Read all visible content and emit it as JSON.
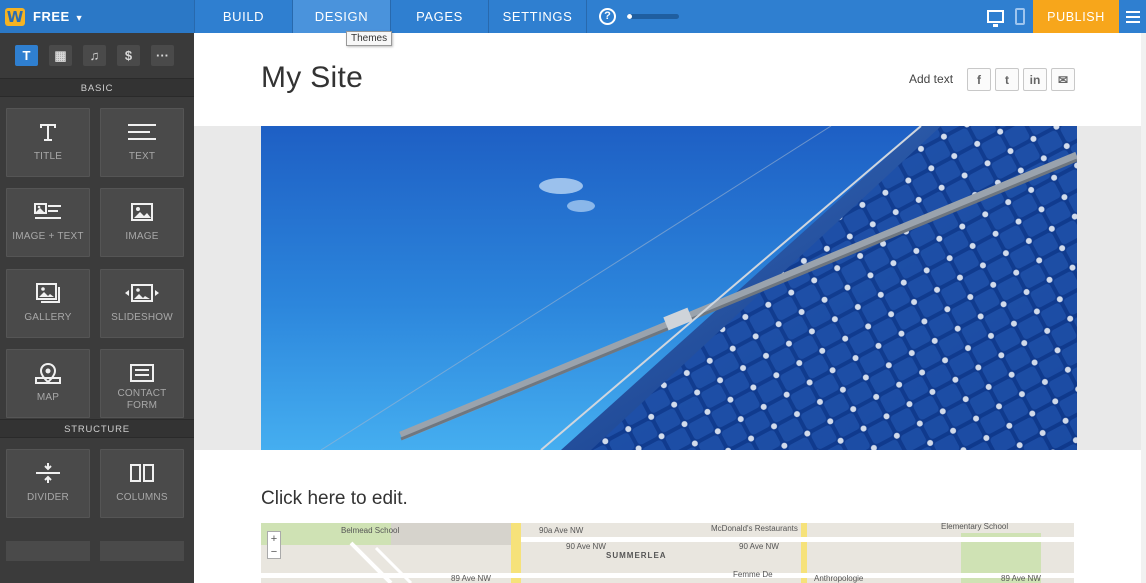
{
  "topbar": {
    "logo_letter": "W",
    "plan_label": "FREE",
    "nav": [
      "BUILD",
      "DESIGN",
      "PAGES",
      "SETTINGS"
    ],
    "active_nav": "DESIGN",
    "help_glyph": "?",
    "publish_label": "PUBLISH",
    "progress": 0.1,
    "colors": {
      "bar": "#2f7fd0",
      "publish": "#f7a61b",
      "active_tab": "#4a93dc"
    }
  },
  "tooltip": "Themes",
  "sidebar": {
    "type_buttons": [
      {
        "label": "T",
        "icon": "text-type-icon"
      },
      {
        "label": "▦",
        "icon": "layout-type-icon"
      },
      {
        "label": "♫",
        "icon": "music-type-icon"
      },
      {
        "label": "$",
        "icon": "commerce-type-icon"
      },
      {
        "label": "···",
        "icon": "more-type-icon"
      }
    ],
    "basic_header": "BASIC",
    "basic": [
      {
        "label": "TITLE",
        "icon": "title-icon"
      },
      {
        "label": "TEXT",
        "icon": "text-icon"
      },
      {
        "label": "IMAGE + TEXT",
        "icon": "image-text-icon"
      },
      {
        "label": "IMAGE",
        "icon": "image-icon"
      },
      {
        "label": "GALLERY",
        "icon": "gallery-icon"
      },
      {
        "label": "SLIDESHOW",
        "icon": "slideshow-icon"
      },
      {
        "label": "MAP",
        "icon": "map-icon"
      },
      {
        "label": "CONTACT FORM",
        "icon": "contact-form-icon"
      }
    ],
    "structure_header": "STRUCTURE",
    "structure": [
      {
        "label": "DIVIDER",
        "icon": "divider-icon"
      },
      {
        "label": "COLUMNS",
        "icon": "columns-icon"
      }
    ]
  },
  "site": {
    "title": "My Site",
    "add_text": "Add text",
    "social": [
      {
        "glyph": "f",
        "icon": "facebook-icon"
      },
      {
        "glyph": "t",
        "icon": "twitter-icon"
      },
      {
        "glyph": "in",
        "icon": "linkedin-icon"
      },
      {
        "glyph": "✉",
        "icon": "email-icon"
      }
    ],
    "edit_prompt": "Click here to edit."
  },
  "map": {
    "labels": [
      "Belmead School",
      "90a Ave NW",
      "90 Ave NW",
      "SUMMERLEA",
      "McDonald's Restaurants",
      "90 Ave NW",
      "Elementary School",
      "89 Ave NW",
      "Femme De",
      "Anthropologie",
      "89 Ave NW"
    ],
    "zoom_in": "+",
    "zoom_out": "−"
  }
}
